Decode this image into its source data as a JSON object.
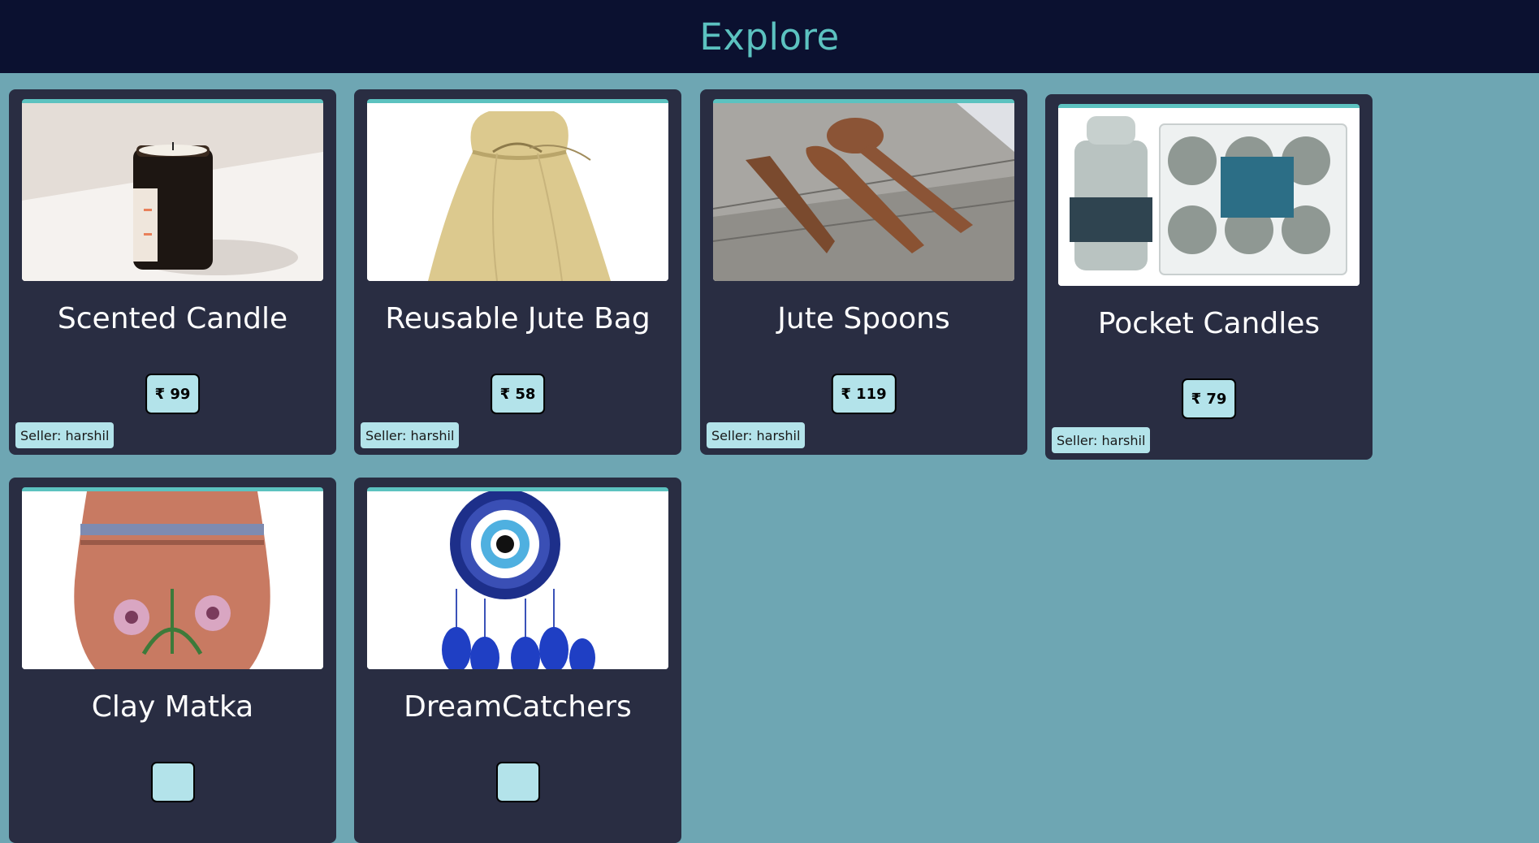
{
  "header": {
    "title": "Explore"
  },
  "products": [
    {
      "name": "Scented Candle",
      "price": "₹ 99",
      "seller": "Seller: harshil",
      "icon": "candle-jar-image"
    },
    {
      "name": "Reusable Jute Bag",
      "price": "₹ 58",
      "seller": "Seller: harshil",
      "icon": "jute-bag-image"
    },
    {
      "name": "Jute Spoons",
      "price": "₹ 119",
      "seller": "Seller: harshil",
      "icon": "wooden-cutlery-image"
    },
    {
      "name": "Pocket Candles",
      "price": "₹ 79",
      "seller": "Seller: harshil",
      "icon": "pocket-candles-image"
    },
    {
      "name": "Clay Matka",
      "price": "",
      "seller": "",
      "icon": "clay-pot-image"
    },
    {
      "name": "DreamCatchers",
      "price": "",
      "seller": "",
      "icon": "dreamcatcher-image"
    }
  ],
  "colors": {
    "header_bg": "#0b1130",
    "title": "#5cc2c0",
    "page_bg": "#6ea6b3",
    "card_bg": "#292d42",
    "badge_bg": "#b3e3ea"
  }
}
